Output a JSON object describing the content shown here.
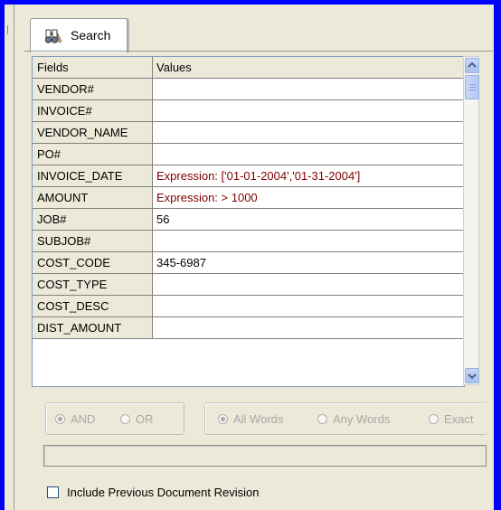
{
  "tab": {
    "label": "Search",
    "icon": "binoculars-icon"
  },
  "table": {
    "headers": [
      "Fields",
      "Values"
    ],
    "rows": [
      {
        "field": "VENDOR#",
        "value": ""
      },
      {
        "field": "INVOICE#",
        "value": ""
      },
      {
        "field": "VENDOR_NAME",
        "value": ""
      },
      {
        "field": "PO#",
        "value": ""
      },
      {
        "field": "INVOICE_DATE",
        "value": "Expression: ['01-01-2004','01-31-2004']"
      },
      {
        "field": "AMOUNT",
        "value": "Expression: > 1000"
      },
      {
        "field": "JOB#",
        "value": "56"
      },
      {
        "field": "SUBJOB#",
        "value": ""
      },
      {
        "field": "COST_CODE",
        "value": "345-6987"
      },
      {
        "field": "COST_TYPE",
        "value": ""
      },
      {
        "field": "COST_DESC",
        "value": ""
      },
      {
        "field": "DIST_AMOUNT",
        "value": ""
      }
    ]
  },
  "logic_options": {
    "and_label": "AND",
    "or_label": "OR",
    "selected": "AND"
  },
  "word_options": {
    "all_words_label": "All Words",
    "any_words_label": "Any Words",
    "exact_label": "Exact",
    "selected": "All Words"
  },
  "text_box": {
    "value": ""
  },
  "include_revision": {
    "label": "Include Previous Document Revision",
    "checked": false
  },
  "colors": {
    "frame": "#0000ff",
    "panel": "#ece9d8",
    "expression_text": "#800000"
  }
}
